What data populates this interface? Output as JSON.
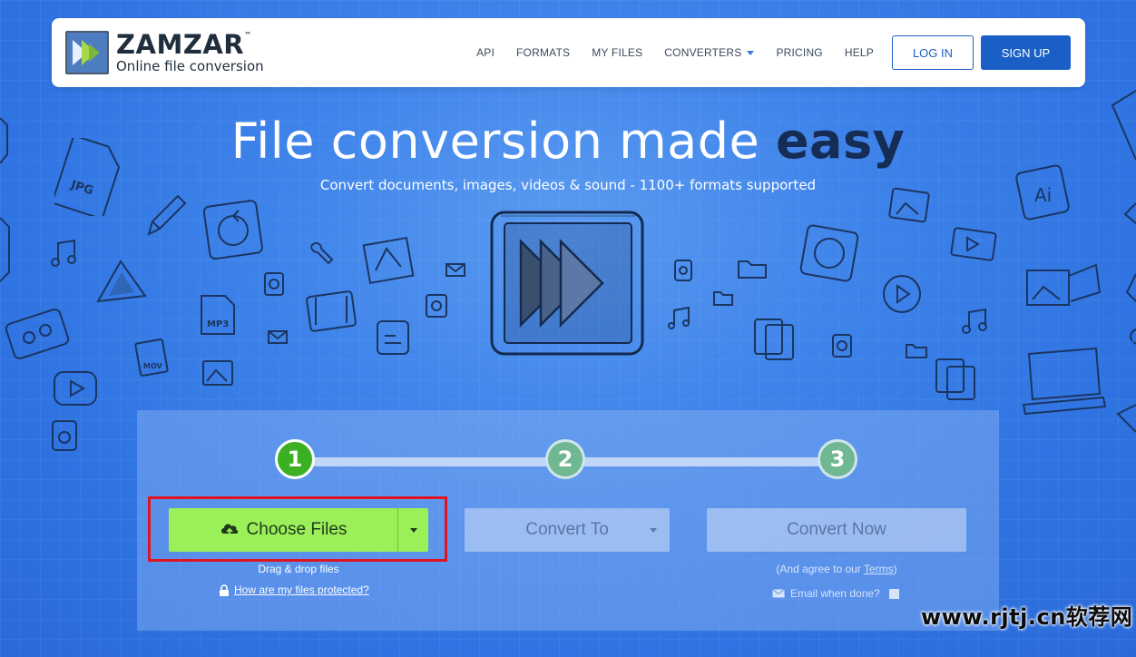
{
  "brand": {
    "name": "ZAMZAR",
    "trademark": "™",
    "tagline": "Online file conversion"
  },
  "nav": {
    "items": [
      {
        "label": "API"
      },
      {
        "label": "FORMATS"
      },
      {
        "label": "MY FILES"
      },
      {
        "label": "CONVERTERS",
        "has_dropdown": true
      },
      {
        "label": "PRICING"
      },
      {
        "label": "HELP"
      }
    ],
    "login_label": "LOG IN",
    "signup_label": "SIGN UP"
  },
  "hero": {
    "title_main": "File conversion made",
    "title_emphasis": "easy",
    "subtitle": "Convert documents, images, videos & sound - 1100+ formats supported"
  },
  "converter": {
    "steps": [
      "1",
      "2",
      "3"
    ],
    "active_step": 1,
    "choose_files_label": "Choose Files",
    "convert_to_label": "Convert To",
    "convert_now_label": "Convert Now",
    "drag_drop_text": "Drag & drop files",
    "protected_link": "How are my files protected?",
    "agree_prefix": "(And agree to our ",
    "agree_terms": "Terms",
    "agree_suffix": ")",
    "email_when_done": "Email when done?"
  },
  "doodle_labels": {
    "jpg": "JPG",
    "mp3": "MP3",
    "mov": "MOV"
  },
  "watermark": "www.rjtj.cn软荐网",
  "colors": {
    "background": "#3f84ea",
    "brand_blue": "#1a5fc6",
    "title_emphasis": "#152c55",
    "choose_green": "#9bf05a",
    "step_active": "#3cb023",
    "highlight_red": "#e0141e"
  }
}
